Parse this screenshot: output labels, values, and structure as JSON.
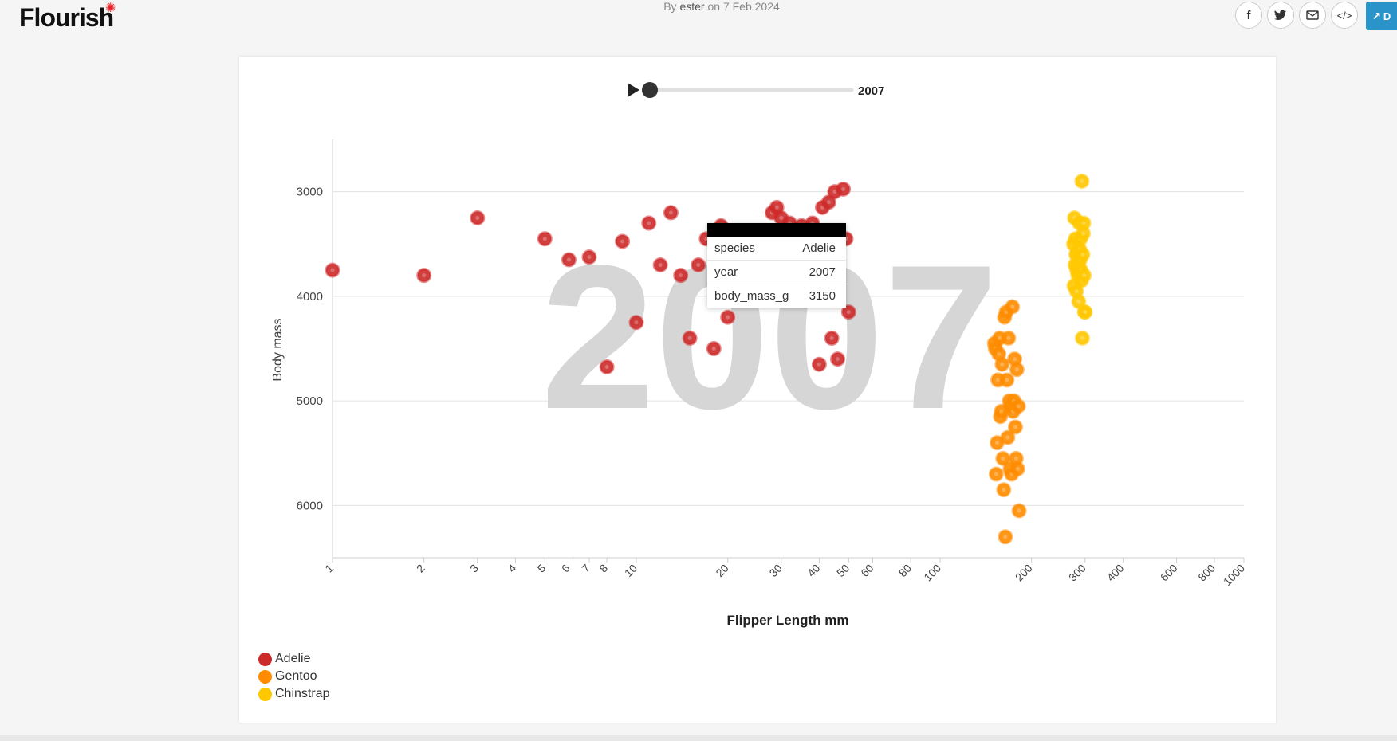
{
  "header": {
    "logo": "Flourish",
    "byline_prefix": "By",
    "author": "ester",
    "byline_on": "on",
    "date": "7 Feb 2024",
    "open_label": "D",
    "share_icons": [
      "facebook-icon",
      "twitter-icon",
      "email-icon",
      "embed-icon",
      "external-link-icon"
    ]
  },
  "timeline": {
    "current": "2007",
    "play_icon": "play-icon"
  },
  "watermark": "2007",
  "tooltip": {
    "rows": [
      {
        "key": "species",
        "value": "Adelie"
      },
      {
        "key": "year",
        "value": "2007"
      },
      {
        "key": "body_mass_g",
        "value": "3150"
      }
    ]
  },
  "legend": [
    {
      "label": "Adelie",
      "color": "#cd2a2a"
    },
    {
      "label": "Gentoo",
      "color": "#ff8c00"
    },
    {
      "label": "Chinstrap",
      "color": "#ffc800"
    }
  ],
  "chart_data": {
    "type": "scatter",
    "xlabel": "Flipper Length mm",
    "ylabel": "Body mass",
    "xscale": "log",
    "xlim": [
      1,
      1000
    ],
    "ylim": [
      6500,
      2500
    ],
    "y_reversed": true,
    "xticks": [
      1,
      2,
      3,
      4,
      5,
      6,
      7,
      8,
      10,
      20,
      30,
      40,
      50,
      60,
      80,
      100,
      200,
      300,
      400,
      600,
      800,
      1000
    ],
    "yticks": [
      3000,
      4000,
      5000,
      6000
    ],
    "grid": true,
    "legend_position": "bottom-left",
    "series": [
      {
        "name": "Adelie",
        "color": "#cd2a2a",
        "points": [
          [
            1,
            3750
          ],
          [
            2,
            3800
          ],
          [
            3,
            3250
          ],
          [
            5,
            3450
          ],
          [
            6,
            3650
          ],
          [
            7,
            3625
          ],
          [
            8,
            4675
          ],
          [
            9,
            3475
          ],
          [
            10,
            4250
          ],
          [
            11,
            3300
          ],
          [
            12,
            3700
          ],
          [
            13,
            3200
          ],
          [
            14,
            3800
          ],
          [
            15,
            4400
          ],
          [
            16,
            3700
          ],
          [
            17,
            3450
          ],
          [
            18,
            4500
          ],
          [
            19,
            3325
          ],
          [
            20,
            4200
          ],
          [
            28,
            3200
          ],
          [
            29,
            3150
          ],
          [
            30,
            3250
          ],
          [
            32,
            3300
          ],
          [
            35,
            3325
          ],
          [
            38,
            3300
          ],
          [
            40,
            4650
          ],
          [
            41,
            3150
          ],
          [
            43,
            3100
          ],
          [
            44,
            4400
          ],
          [
            45,
            3000
          ],
          [
            46,
            4600
          ],
          [
            48,
            2975
          ],
          [
            49,
            3450
          ],
          [
            50,
            4150
          ]
        ]
      },
      {
        "name": "Gentoo",
        "color": "#ff8c00",
        "points": [
          [
            151,
            4450
          ],
          [
            152,
            4500
          ],
          [
            153,
            5700
          ],
          [
            154,
            5400
          ],
          [
            155,
            4800
          ],
          [
            156,
            4550
          ],
          [
            157,
            4400
          ],
          [
            158,
            5150
          ],
          [
            159,
            5100
          ],
          [
            160,
            4650
          ],
          [
            161,
            5550
          ],
          [
            162,
            5850
          ],
          [
            163,
            4200
          ],
          [
            164,
            6300
          ],
          [
            165,
            4150
          ],
          [
            166,
            4800
          ],
          [
            167,
            5350
          ],
          [
            168,
            4400
          ],
          [
            169,
            5000
          ],
          [
            170,
            5650
          ],
          [
            171,
            5050
          ],
          [
            172,
            5700
          ],
          [
            173,
            4100
          ],
          [
            174,
            5100
          ],
          [
            175,
            5000
          ],
          [
            176,
            4600
          ],
          [
            177,
            5250
          ],
          [
            178,
            5550
          ],
          [
            179,
            4700
          ],
          [
            180,
            5650
          ],
          [
            181,
            5050
          ],
          [
            182,
            6050
          ]
        ]
      },
      {
        "name": "Chinstrap",
        "color": "#ffc800",
        "points": [
          [
            275,
            3500
          ],
          [
            276,
            3900
          ],
          [
            277,
            3250
          ],
          [
            278,
            3700
          ],
          [
            279,
            3450
          ],
          [
            280,
            3600
          ],
          [
            281,
            3950
          ],
          [
            282,
            3750
          ],
          [
            283,
            3575
          ],
          [
            284,
            3800
          ],
          [
            285,
            3700
          ],
          [
            286,
            4050
          ],
          [
            287,
            3300
          ],
          [
            288,
            3550
          ],
          [
            289,
            3650
          ],
          [
            290,
            3450
          ],
          [
            291,
            3750
          ],
          [
            292,
            3850
          ],
          [
            293,
            2900
          ],
          [
            294,
            4400
          ],
          [
            295,
            3600
          ],
          [
            296,
            3400
          ],
          [
            297,
            3300
          ],
          [
            298,
            3800
          ],
          [
            299,
            4150
          ],
          [
            300,
            4150
          ]
        ]
      }
    ]
  }
}
